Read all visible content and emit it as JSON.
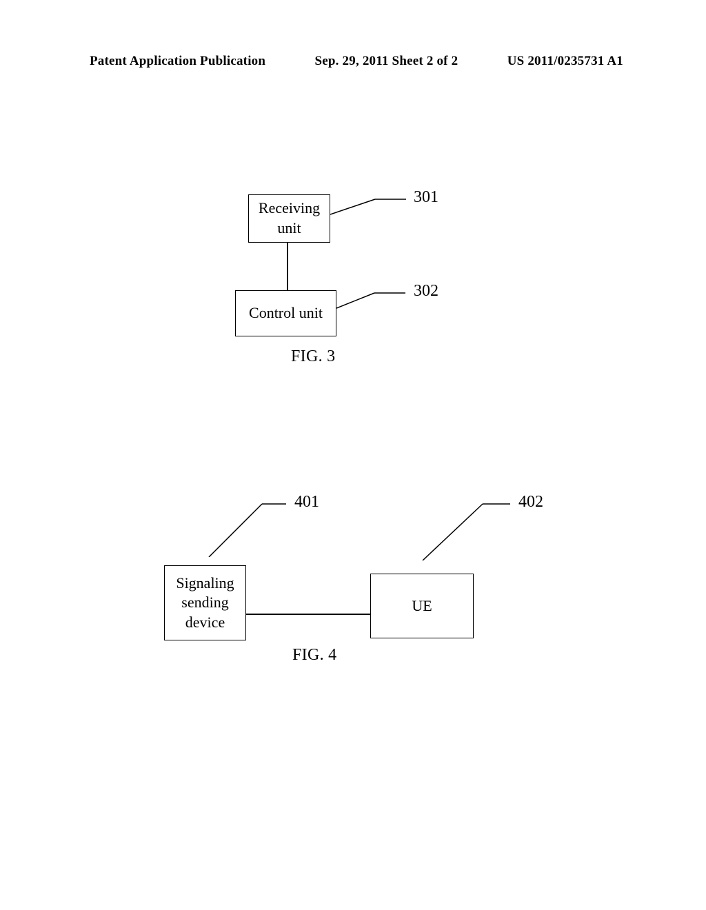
{
  "header": {
    "left": "Patent Application Publication",
    "center": "Sep. 29, 2011  Sheet 2 of 2",
    "right": "US 2011/0235731 A1"
  },
  "fig3": {
    "box1": {
      "label": "Receiving unit",
      "ref": "301"
    },
    "box2": {
      "label": "Control unit",
      "ref": "302"
    },
    "caption": "FIG. 3"
  },
  "fig4": {
    "box1": {
      "label": "Signaling sending device",
      "ref": "401"
    },
    "box2": {
      "label": "UE",
      "ref": "402"
    },
    "caption": "FIG. 4"
  }
}
